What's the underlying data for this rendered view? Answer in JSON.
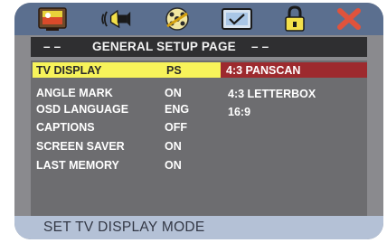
{
  "toolbar": {
    "icons": [
      "general-setup-tv-icon",
      "audio-speaker-icon",
      "video-film-reel-icon",
      "preference-check-icon",
      "password-lock-icon",
      "exit-x-icon"
    ]
  },
  "title": {
    "left_dash": "– –",
    "label": "GENERAL SETUP PAGE",
    "right_dash": "– –"
  },
  "settings": [
    {
      "label": "TV DISPLAY",
      "value": "PS"
    },
    {
      "label": "ANGLE MARK",
      "value": "ON"
    },
    {
      "label": "OSD LANGUAGE",
      "value": "ENG"
    },
    {
      "label": "CAPTIONS",
      "value": "OFF"
    },
    {
      "label": "SCREEN SAVER",
      "value": "ON"
    },
    {
      "label": "LAST MEMORY",
      "value": "ON"
    }
  ],
  "options": [
    "4:3 PANSCAN",
    "4:3 LETTERBOX",
    "16:9"
  ],
  "footer": {
    "hint": "SET TV DISPLAY MODE"
  },
  "colors": {
    "frame": "#8a8a8e",
    "toolbar": "#5b6f8f",
    "selection_bar": "#f7f35a",
    "option_selected": "#9d2a2e",
    "footer": "#b4c1d6"
  }
}
